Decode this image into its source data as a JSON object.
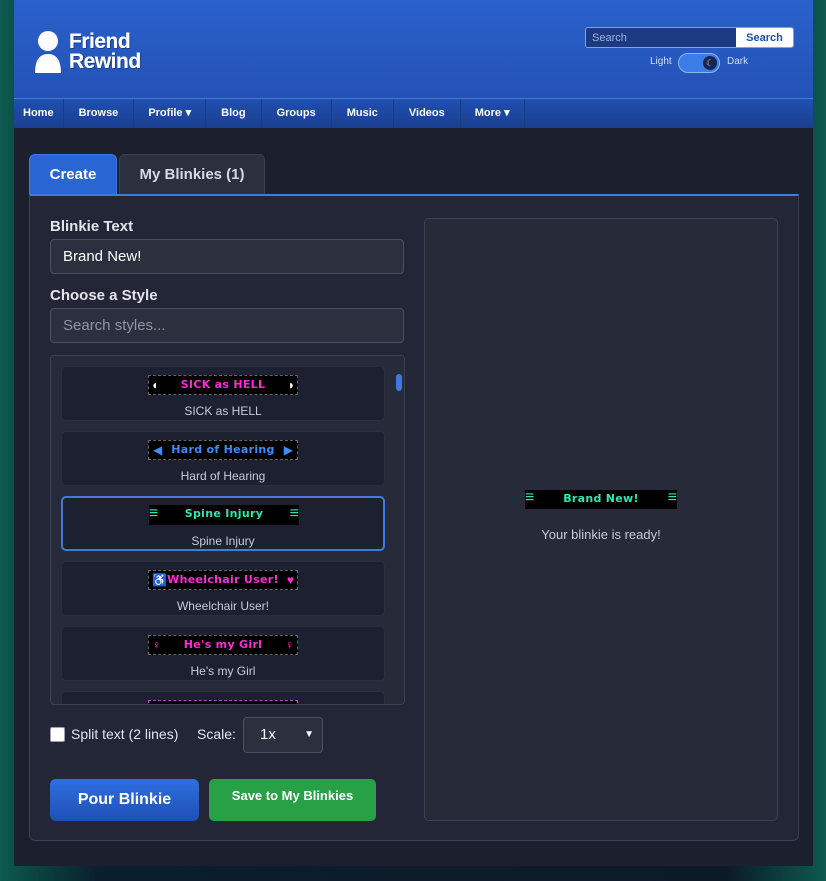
{
  "site": {
    "logo_line1": "Friend",
    "logo_line2": "Rewind"
  },
  "search": {
    "placeholder": "Search",
    "button_label": "Search"
  },
  "theme": {
    "light_label": "Light",
    "dark_label": "Dark",
    "mode": "dark"
  },
  "nav": {
    "items": [
      {
        "label": "Home"
      },
      {
        "label": "Browse"
      },
      {
        "label": "Profile ▾"
      },
      {
        "label": "Blog"
      },
      {
        "label": "Groups"
      },
      {
        "label": "Music"
      },
      {
        "label": "Videos"
      },
      {
        "label": "More ▾"
      }
    ]
  },
  "tabs": {
    "create": "Create",
    "mine": "My Blinkies (1)"
  },
  "form": {
    "text_label": "Blinkie Text",
    "text_value": "Brand New!",
    "style_label": "Choose a Style",
    "style_search_placeholder": "Search styles...",
    "split_label": "Split text (2 lines)",
    "scale_label": "Scale:",
    "scale_value": "1x",
    "pour_button": "Pour Blinkie",
    "save_button": "Save to My Blinkies"
  },
  "styles": [
    {
      "name": "SICK as HELL",
      "text": "SICK as HELL",
      "color": "#ff2bd6",
      "icon": "pill-icon",
      "glyph": "◖"
    },
    {
      "name": "Hard of Hearing",
      "text": "Hard of Hearing",
      "color": "#3b8cff",
      "icon": "speaker-icon",
      "glyph": "◀"
    },
    {
      "name": "Spine Injury",
      "text": "Spine Injury",
      "color": "#2ee6b0",
      "icon": "spine-icon",
      "glyph": "≡"
    },
    {
      "name": "Wheelchair User!",
      "text": "Wheelchair User!",
      "color": "#ff2bd6",
      "icon": "wheelchair-icon",
      "glyph": "♿"
    },
    {
      "name": "He's my Girl",
      "text": "He's my Girl",
      "color": "#ff2bd6",
      "icon": "symbol-icon",
      "glyph": "♀"
    }
  ],
  "selected_style": "Spine Injury",
  "preview": {
    "blinkie_text": "Brand New!",
    "blinkie_color": "#2ee6b0",
    "status": "Your blinkie is ready!"
  }
}
